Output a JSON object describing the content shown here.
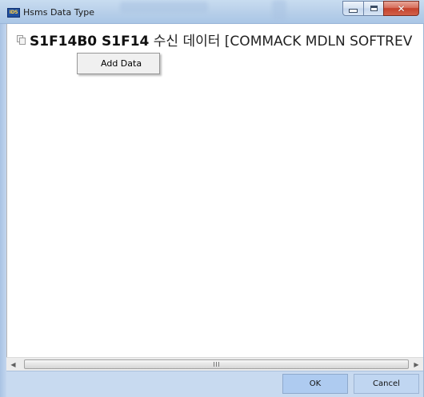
{
  "window": {
    "title": "Hsms Data Type",
    "app_icon_text": "IDS"
  },
  "tree": {
    "node_id": "S1F14B0 S1F14",
    "node_desc": "수신 데이터 [COMMACK MDLN SOFTREV"
  },
  "context_menu": {
    "items": [
      {
        "label": "Add Data"
      }
    ]
  },
  "scrollbar": {
    "grip": "III"
  },
  "buttons": {
    "ok_label": "OK",
    "cancel_label": "Cancel"
  }
}
